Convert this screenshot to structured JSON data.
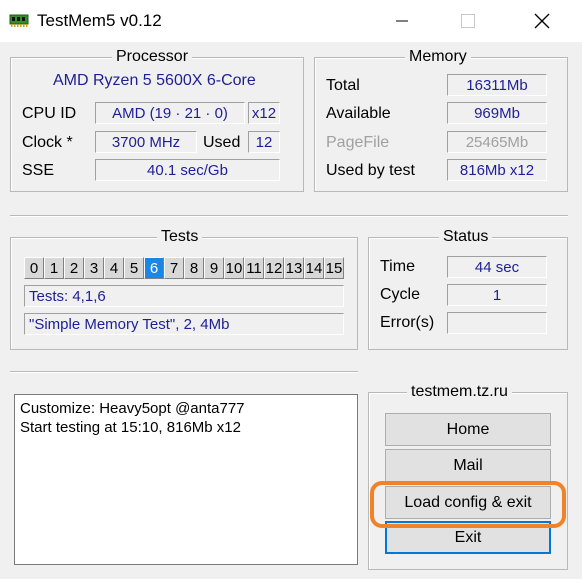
{
  "window": {
    "title": "TestMem5 v0.12",
    "minimize_glyph": "—",
    "maximize_glyph": "☐",
    "close_glyph": "✕"
  },
  "processor": {
    "group_title": "Processor",
    "name": "AMD Ryzen 5 5600X 6-Core",
    "cpu_id_label": "CPU ID",
    "cpu_id_value": "AMD  (19 · 21 · 0)",
    "threads": "x12",
    "clock_label": "Clock *",
    "clock_value": "3700 MHz",
    "used_label": "Used",
    "used_value": "12",
    "sse_label": "SSE",
    "sse_value": "40.1 sec/Gb"
  },
  "memory": {
    "group_title": "Memory",
    "total_label": "Total",
    "total_value": "16311Mb",
    "available_label": "Available",
    "available_value": "969Mb",
    "pagefile_label": "PageFile",
    "pagefile_value": "25465Mb",
    "used_by_test_label": "Used by test",
    "used_by_test_value": "816Mb x12"
  },
  "tests": {
    "group_title": "Tests",
    "numbers": [
      "0",
      "1",
      "2",
      "3",
      "4",
      "5",
      "6",
      "7",
      "8",
      "9",
      "10",
      "11",
      "12",
      "13",
      "14",
      "15"
    ],
    "active_index": 6,
    "tests_line": "Tests: 4,1,6",
    "current_test": "\"Simple Memory Test\", 2, 4Mb"
  },
  "status": {
    "group_title": "Status",
    "time_label": "Time",
    "time_value": "44 sec",
    "cycle_label": "Cycle",
    "cycle_value": "1",
    "errors_label": "Error(s)",
    "errors_value": ""
  },
  "log": {
    "line1": "Customize: Heavy5opt @anta777",
    "line2": "Start testing at 15:10, 816Mb x12"
  },
  "links": {
    "group_title": "testmem.tz.ru",
    "home_label": "Home",
    "mail_label": "Mail",
    "load_config_label": "Load config & exit",
    "exit_label": "Exit"
  },
  "colors": {
    "value_text": "#1e1e96",
    "active_test": "#1a87e8",
    "highlight": "#f0822a",
    "exit_focus": "#0078d7"
  }
}
